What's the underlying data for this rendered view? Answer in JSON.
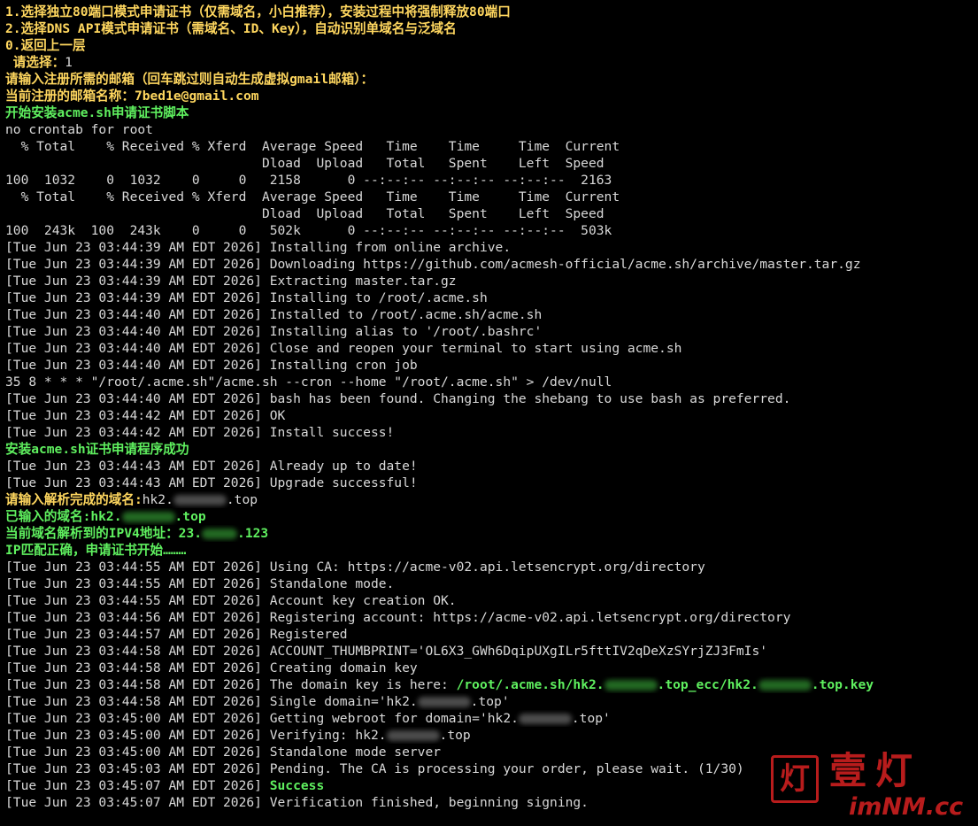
{
  "terminal": {
    "lines": [
      [
        {
          "t": "1.选择独立80端口模式申请证书（仅需域名，小白推荐），安装过程中将强制释放80端口",
          "c": "yellow"
        }
      ],
      [
        {
          "t": "2.选择DNS API模式申请证书（需域名、ID、Key），自动识别单域名与泛域名",
          "c": "yellow"
        }
      ],
      [
        {
          "t": "0.返回上一层",
          "c": "yellow"
        }
      ],
      [
        {
          "t": " 请选择：",
          "c": "yellow"
        },
        {
          "t": "1"
        }
      ],
      [
        {
          "t": "请输入注册所需的邮箱（回车跳过则自动生成虚拟gmail邮箱）：",
          "c": "yellow"
        }
      ],
      [
        {
          "t": "当前注册的邮箱名称：7bed1e@gmail.com",
          "c": "yellow"
        }
      ],
      [
        {
          "t": "开始安装acme.sh申请证书脚本",
          "c": "green"
        }
      ],
      [
        {
          "t": "no crontab for root"
        }
      ],
      [
        {
          "t": "  % Total    % Received % Xferd  Average Speed   Time    Time     Time  Current"
        }
      ],
      [
        {
          "t": "                                 Dload  Upload   Total   Spent    Left  Speed"
        }
      ],
      [
        {
          "t": "100  1032    0  1032    0     0   2158      0 --:--:-- --:--:-- --:--:--  2163"
        }
      ],
      [
        {
          "t": "  % Total    % Received % Xferd  Average Speed   Time    Time     Time  Current"
        }
      ],
      [
        {
          "t": "                                 Dload  Upload   Total   Spent    Left  Speed"
        }
      ],
      [
        {
          "t": "100  243k  100  243k    0     0   502k      0 --:--:-- --:--:-- --:--:--  503k"
        }
      ],
      [
        {
          "t": "[Tue Jun 23 03:44:39 AM EDT 2026] Installing from online archive."
        }
      ],
      [
        {
          "t": "[Tue Jun 23 03:44:39 AM EDT 2026] Downloading https://github.com/acmesh-official/acme.sh/archive/master.tar.gz"
        }
      ],
      [
        {
          "t": "[Tue Jun 23 03:44:39 AM EDT 2026] Extracting master.tar.gz"
        }
      ],
      [
        {
          "t": "[Tue Jun 23 03:44:39 AM EDT 2026] Installing to /root/.acme.sh"
        }
      ],
      [
        {
          "t": "[Tue Jun 23 03:44:40 AM EDT 2026] Installed to /root/.acme.sh/acme.sh"
        }
      ],
      [
        {
          "t": "[Tue Jun 23 03:44:40 AM EDT 2026] Installing alias to '/root/.bashrc'"
        }
      ],
      [
        {
          "t": "[Tue Jun 23 03:44:40 AM EDT 2026] Close and reopen your terminal to start using acme.sh"
        }
      ],
      [
        {
          "t": "[Tue Jun 23 03:44:40 AM EDT 2026] Installing cron job"
        }
      ],
      [
        {
          "t": "35 8 * * * \"/root/.acme.sh\"/acme.sh --cron --home \"/root/.acme.sh\" > /dev/null"
        }
      ],
      [
        {
          "t": "[Tue Jun 23 03:44:40 AM EDT 2026] bash has been found. Changing the shebang to use bash as preferred."
        }
      ],
      [
        {
          "t": "[Tue Jun 23 03:44:42 AM EDT 2026] OK"
        }
      ],
      [
        {
          "t": "[Tue Jun 23 03:44:42 AM EDT 2026] Install success!"
        }
      ],
      [
        {
          "t": "安装acme.sh证书申请程序成功",
          "c": "green"
        }
      ],
      [
        {
          "t": "[Tue Jun 23 03:44:43 AM EDT 2026] Already up to date!"
        }
      ],
      [
        {
          "t": "[Tue Jun 23 03:44:43 AM EDT 2026] Upgrade successful!"
        }
      ],
      [
        {
          "t": "请输入解析完成的域名:",
          "c": "yellow"
        },
        {
          "t": "hk2."
        },
        {
          "blur": true
        },
        {
          "t": ".top"
        }
      ],
      [
        {
          "t": "已输入的域名:hk2.",
          "c": "green"
        },
        {
          "blur": true,
          "c": "green"
        },
        {
          "t": ".top",
          "c": "green"
        }
      ],
      [
        {
          "t": "当前域名解析到的IPV4地址：23.",
          "c": "green"
        },
        {
          "blur": true,
          "c": "green",
          "short": true
        },
        {
          "t": ".123",
          "c": "green"
        }
      ],
      [
        {
          "t": "IP匹配正确，申请证书开始………",
          "c": "green"
        }
      ],
      [
        {
          "t": "[Tue Jun 23 03:44:55 AM EDT 2026] Using CA: https://acme-v02.api.letsencrypt.org/directory"
        }
      ],
      [
        {
          "t": "[Tue Jun 23 03:44:55 AM EDT 2026] Standalone mode."
        }
      ],
      [
        {
          "t": "[Tue Jun 23 03:44:55 AM EDT 2026] Account key creation OK."
        }
      ],
      [
        {
          "t": "[Tue Jun 23 03:44:56 AM EDT 2026] Registering account: https://acme-v02.api.letsencrypt.org/directory"
        }
      ],
      [
        {
          "t": "[Tue Jun 23 03:44:57 AM EDT 2026] Registered"
        }
      ],
      [
        {
          "t": "[Tue Jun 23 03:44:58 AM EDT 2026] ACCOUNT_THUMBPRINT='OL6X3_GWh6DqipUXgILr5fttIV2qDeXzSYrjZJ3FmIs'"
        }
      ],
      [
        {
          "t": "[Tue Jun 23 03:44:58 AM EDT 2026] Creating domain key"
        }
      ],
      [
        {
          "t": "[Tue Jun 23 03:44:58 AM EDT 2026] The domain key is here: "
        },
        {
          "t": "/root/.acme.sh/hk2.",
          "c": "green"
        },
        {
          "blur": true,
          "c": "green"
        },
        {
          "t": ".top_ecc/hk2.",
          "c": "green"
        },
        {
          "blur": true,
          "c": "green"
        },
        {
          "t": ".top.key",
          "c": "green"
        }
      ],
      [
        {
          "t": "[Tue Jun 23 03:44:58 AM EDT 2026] Single domain='hk2."
        },
        {
          "blur": true
        },
        {
          "t": ".top'"
        }
      ],
      [
        {
          "t": "[Tue Jun 23 03:45:00 AM EDT 2026] Getting webroot for domain='hk2."
        },
        {
          "blur": true
        },
        {
          "t": ".top'"
        }
      ],
      [
        {
          "t": "[Tue Jun 23 03:45:00 AM EDT 2026] Verifying: hk2."
        },
        {
          "blur": true
        },
        {
          "t": ".top"
        }
      ],
      [
        {
          "t": "[Tue Jun 23 03:45:00 AM EDT 2026] Standalone mode server"
        }
      ],
      [
        {
          "t": "[Tue Jun 23 03:45:03 AM EDT 2026] Pending. The CA is processing your order, please wait. (1/30)"
        }
      ],
      [
        {
          "t": "[Tue Jun 23 03:45:07 AM EDT 2026] "
        },
        {
          "t": "Success",
          "c": "green"
        }
      ],
      [
        {
          "t": "[Tue Jun 23 03:45:07 AM EDT 2026] Verification finished, beginning signing."
        }
      ]
    ]
  },
  "watermark": {
    "seal_char": "灯",
    "title": "壹灯",
    "domain": "imNM.cc"
  },
  "colors": {
    "background": "#000000",
    "text": "#d9d9d9",
    "prompt_yellow": "#ffd75f",
    "success_green": "#5ff05f",
    "watermark_red": "#b81c1c"
  }
}
